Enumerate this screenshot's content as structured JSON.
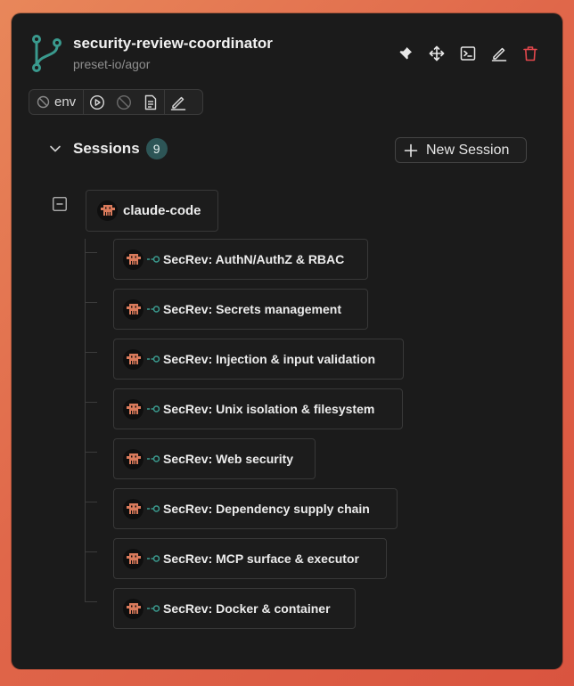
{
  "worktree": {
    "title": "security-review-coordinator",
    "repo": "preset-io/agor",
    "accent_color": "#3a9a8e"
  },
  "header_actions": [
    {
      "icon": "pin-icon"
    },
    {
      "icon": "move-icon"
    },
    {
      "icon": "terminal-icon"
    },
    {
      "icon": "edit-icon"
    },
    {
      "icon": "trash-icon",
      "color": "#e5484d"
    }
  ],
  "toolbar": {
    "env_label": "env",
    "buttons": [
      "play-icon",
      "stop-icon",
      "document-icon",
      "edit-icon"
    ]
  },
  "sessions": {
    "label": "Sessions",
    "count": "9",
    "new_button_label": "New Session",
    "root": {
      "label": "claude-code"
    },
    "children": [
      {
        "label": "SecRev: AuthN/AuthZ & RBAC"
      },
      {
        "label": "SecRev: Secrets management"
      },
      {
        "label": "SecRev: Injection & input validation"
      },
      {
        "label": "SecRev: Unix isolation & filesystem"
      },
      {
        "label": "SecRev: Web security"
      },
      {
        "label": "SecRev: Dependency supply chain"
      },
      {
        "label": "SecRev: MCP surface & executor"
      },
      {
        "label": "SecRev: Docker & container"
      }
    ]
  }
}
